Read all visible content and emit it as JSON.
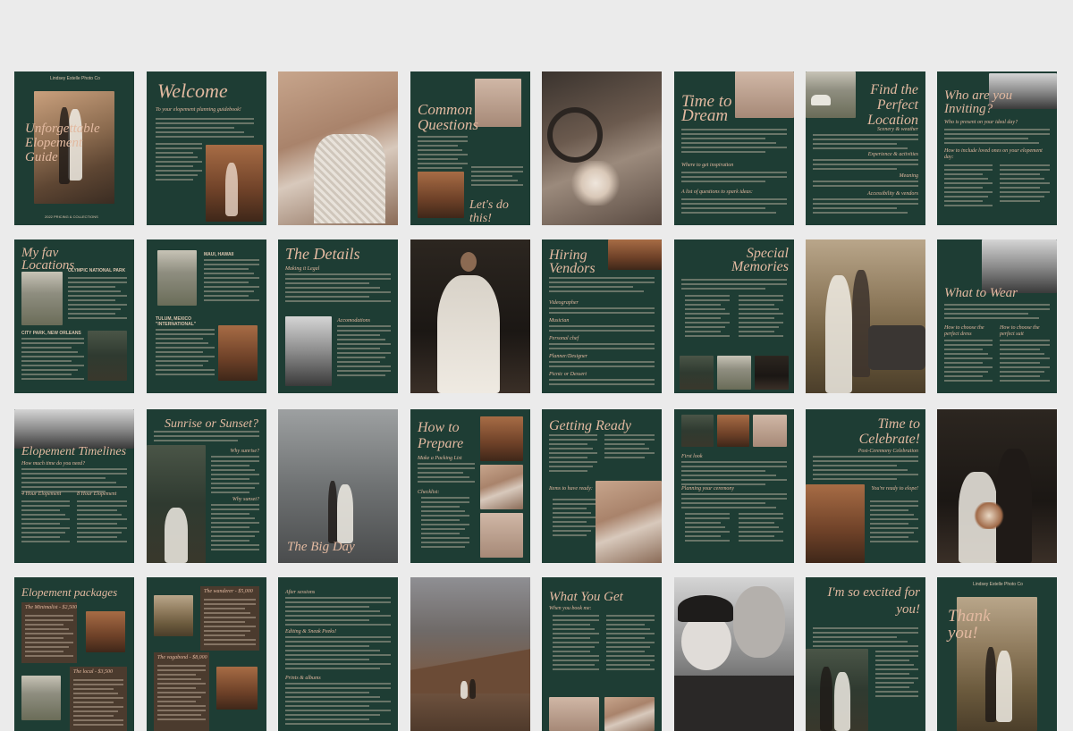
{
  "brand": "Lindsey Estelle Photo Co",
  "pages": {
    "p1": {
      "title": "Unforgettable Elopement Guide",
      "footer": "2022 PRICING & COLLECTIONS"
    },
    "p2": {
      "title": "Welcome",
      "subtitle": "To your elopement planning guidebook!"
    },
    "p4": {
      "title": "Common Questions",
      "cta": "Let's do this!"
    },
    "p6": {
      "title": "Time to Dream",
      "h1": "Where to get inspiration",
      "h2": "A list of questions to spark ideas:"
    },
    "p7": {
      "title": "Find the Perfect Location",
      "h1": "Scenery & weather",
      "h2": "Experience & activities",
      "h3": "Meaning",
      "h4": "Accessibility & vendors"
    },
    "p8": {
      "title": "Who are you Inviting?",
      "subtitle": "Who is present on your ideal day?",
      "h1": "How to include loved ones on your elopement day:"
    },
    "p9": {
      "title": "My fav Locations",
      "loc1": "OLYMPIC NATIONAL PARK",
      "loc2": "CITY PARK, NEW ORLEANS"
    },
    "p10": {
      "loc1": "MAUI, HAWAII",
      "loc2": "TULUM, MEXICO \"INTERNATIONAL\""
    },
    "p11": {
      "title": "The Details",
      "h1": "Making it Legal",
      "h2": "Accomodations"
    },
    "p13": {
      "title": "Hiring Vendors",
      "h1": "Videographer",
      "h2": "Musician",
      "h3": "Personal chef",
      "h4": "Planner/Designer",
      "h5": "Picnic or Dessert"
    },
    "p14": {
      "title": "Special Memories"
    },
    "p16": {
      "title": "What to Wear",
      "h1": "How to choose the perfect dress",
      "h2": "How to choose the perfect suit"
    },
    "p17": {
      "title": "Elopement Timelines",
      "h1": "How much time do you need?",
      "h2": "4 Hour Elopement",
      "h3": "8 Hour Elopement"
    },
    "p18": {
      "title": "Sunrise or Sunset?",
      "h1": "Why sunrise?",
      "h2": "Why sunset?"
    },
    "p19": {
      "title": "The Big Day"
    },
    "p20": {
      "title": "How to Prepare",
      "h1": "Make a Packing List",
      "h2": "Checklist:"
    },
    "p21": {
      "title": "Getting Ready",
      "h1": "Items to have ready:"
    },
    "p22": {
      "h1": "First look",
      "h2": "Planning your ceremony"
    },
    "p23": {
      "title": "Time to Celebrate!",
      "subtitle": "Post-Ceremony Celebration",
      "h1": "You're ready to elope!"
    },
    "p25": {
      "title": "Elopement packages",
      "box1": "The Minimalist - $2,500",
      "box2": "The local - $3,500"
    },
    "p26": {
      "box1": "The wanderer - $5,000",
      "box2": "The vagabond - $8,000"
    },
    "p27": {
      "h1": "After sessions",
      "h2": "Editing & Sneak Peeks!",
      "h3": "Prints & albums"
    },
    "p29": {
      "title": "What You Get",
      "subtitle": "When you book me:"
    },
    "p31": {
      "title": "I'm so excited for you!"
    },
    "p32": {
      "title": "Thank you!",
      "footer": "2022 PRICING GUIDE"
    }
  },
  "colors": {
    "background": "#ebebeb",
    "page_green": "#1e3d34",
    "accent_peach": "#e2b9a0",
    "box_brown": "#4b3b2e"
  }
}
